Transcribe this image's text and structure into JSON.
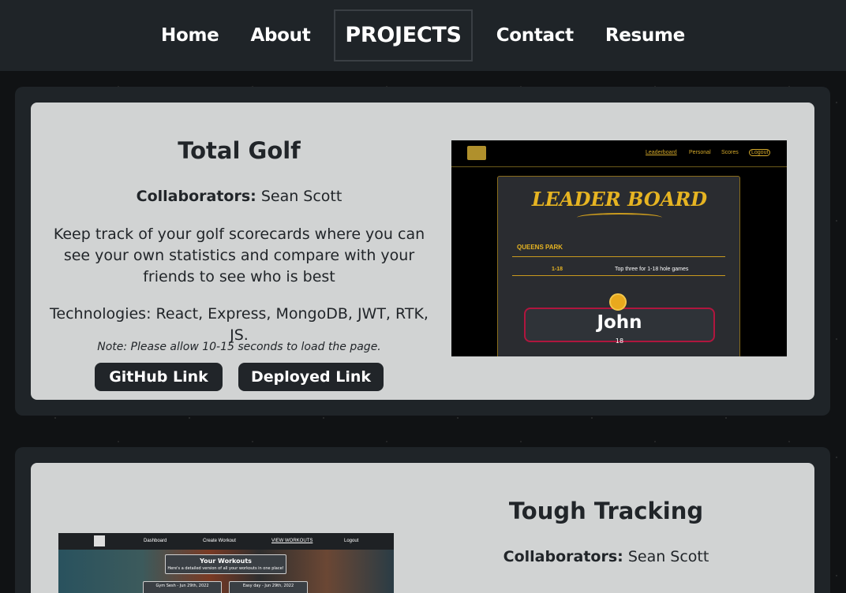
{
  "nav": {
    "items": [
      "Home",
      "About",
      "PROJECTS",
      "Contact",
      "Resume"
    ],
    "active": "PROJECTS"
  },
  "projects": [
    {
      "title": "Total Golf",
      "collaborators_label": "Collaborators:",
      "collaborators": "Sean Scott",
      "description": "Keep track of your golf scorecards where you can see your own statistics and compare with your friends to see who is best",
      "technologies": "Technologies: React, Express, MongoDB, JWT, RTK, JS.",
      "note": "Note: Please allow 10-15 seconds to load the page.",
      "github_label": "GitHub Link",
      "deployed_label": "Deployed Link",
      "screenshot": {
        "nav_links": [
          "Leaderboard",
          "Personal",
          "Scores",
          "Logout"
        ],
        "heading": "LEADER BOARD",
        "course": "QUEENS PARK",
        "holes": "1-18",
        "caption": "Top three for 1-18 hole games",
        "leader_name": "John",
        "leader_score": "18"
      }
    },
    {
      "title": "Tough Tracking",
      "collaborators_label": "Collaborators:",
      "collaborators": "Sean Scott",
      "screenshot": {
        "nav_links": [
          "Dashboard",
          "Create Workout",
          "VIEW WORKOUTS",
          "Logout"
        ],
        "heading": "Your Workouts",
        "subheading": "Here's a detailed version of all your workouts in one place!",
        "cards": [
          "Gym Sesh - Jun 29th, 2022",
          "Easy day - Jun 29th, 2022"
        ]
      }
    }
  ]
}
